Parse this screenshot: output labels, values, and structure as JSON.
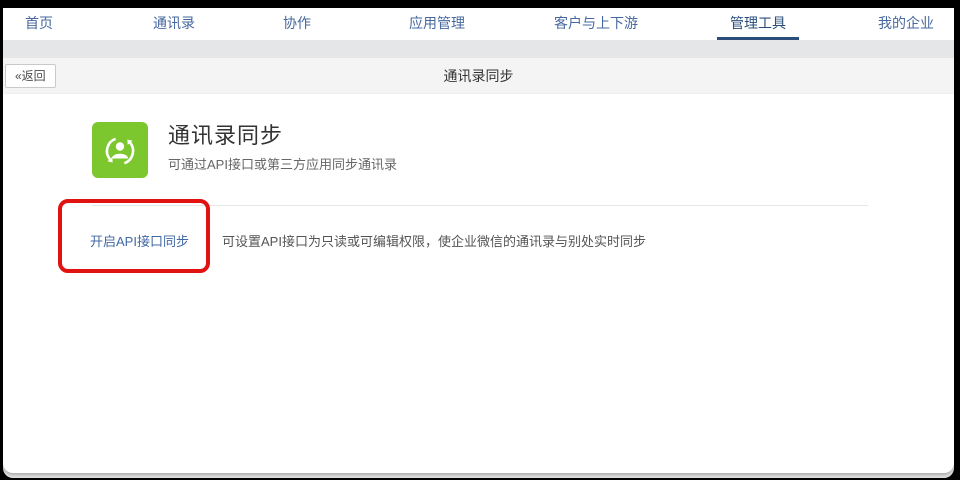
{
  "nav": {
    "items": [
      {
        "label": "首页",
        "active": false
      },
      {
        "label": "通讯录",
        "active": false
      },
      {
        "label": "协作",
        "active": false
      },
      {
        "label": "应用管理",
        "active": false
      },
      {
        "label": "客户与上下游",
        "active": false
      },
      {
        "label": "管理工具",
        "active": true
      },
      {
        "label": "我的企业",
        "active": false
      }
    ]
  },
  "toolbar": {
    "back_label": "«返回",
    "title": "通讯录同步"
  },
  "main": {
    "icon": "contact-sync-icon",
    "icon_color": "#7bc72d",
    "title": "通讯录同步",
    "subtitle": "可通过API接口或第三方应用同步通讯录",
    "settings_row": {
      "link_label": "开启API接口同步",
      "description": "可设置API接口为只读或可编辑权限，使企业微信的通讯录与别处实时同步"
    }
  },
  "annotation": {
    "type": "highlight-box",
    "color": "#e01212"
  },
  "colors": {
    "nav_link": "#47689f",
    "nav_active": "#2a4d7a",
    "link": "#4268a3",
    "toolbar_bg": "#f4f4f4",
    "frame_bg": "#000000"
  }
}
